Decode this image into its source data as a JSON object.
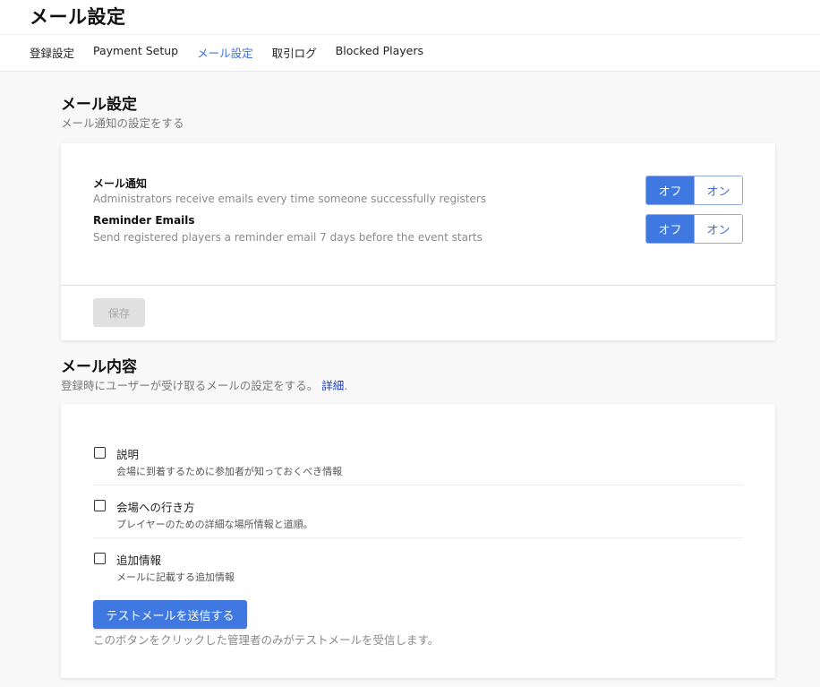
{
  "header": {
    "title": "メール設定",
    "tabs": [
      {
        "label": "登録設定",
        "active": false
      },
      {
        "label": "Payment Setup",
        "active": false
      },
      {
        "label": "メール設定",
        "active": true
      },
      {
        "label": "取引ログ",
        "active": false
      },
      {
        "label": "Blocked Players",
        "active": false
      }
    ]
  },
  "email_settings": {
    "title": "メール設定",
    "subtitle": "メール通知の設定をする",
    "items": [
      {
        "title": "メール通知",
        "description": "Administrators receive emails every time someone successfully registers",
        "off_label": "オフ",
        "on_label": "オン",
        "selected": "off"
      },
      {
        "title": "Reminder Emails",
        "description": "Send registered players a reminder email 7 days before the event starts",
        "off_label": "オフ",
        "on_label": "オン",
        "selected": "off"
      }
    ],
    "save_label": "保存"
  },
  "email_content": {
    "title": "メール内容",
    "subtitle": "登録時にユーザーが受け取るメールの設定をする。",
    "detail_link": "詳細",
    "options": [
      {
        "label": "説明",
        "description": "会場に到着するために参加者が知っておくべき情報",
        "checked": false
      },
      {
        "label": "会場への行き方",
        "description": "プレイヤーのための詳細な場所情報と道順。",
        "checked": false
      },
      {
        "label": "追加情報",
        "description": "メールに記載する追加情報",
        "checked": false
      }
    ],
    "test_button_label": "テストメールを送信する",
    "test_note": "このボタンをクリックした管理者のみがテストメールを受信します。"
  },
  "colors": {
    "accent": "#3f78e0",
    "active_tab": "#3f6fd9",
    "link": "#1a3db5"
  }
}
